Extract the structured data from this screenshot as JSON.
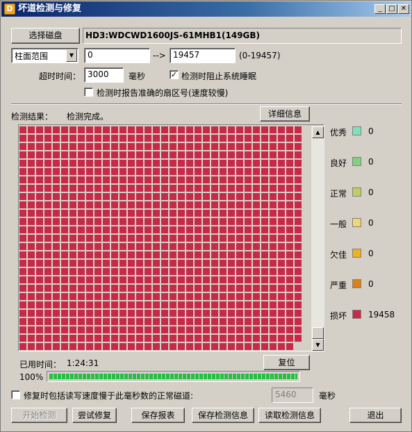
{
  "window": {
    "title": "坏道检测与修复",
    "app_icon": "app-icon"
  },
  "disk": {
    "select_label": "选择磁盘",
    "name": "HD3:WDCWD1600JS-61MHB1(149GB)"
  },
  "range": {
    "mode": "柱面范围",
    "from": "0",
    "arrow": "-->",
    "to": "19457",
    "hint": "(0-19457)"
  },
  "timeout": {
    "label": "超时时间：",
    "value": "3000",
    "unit": "毫秒"
  },
  "options": {
    "prevent_sleep": "检测时阻止系统睡眠",
    "prevent_sleep_checked": true,
    "report_sectors": "检测时报告准确的扇区号(速度较慢)",
    "report_sectors_checked": false
  },
  "result": {
    "label": "检测结果：",
    "status": "检测完成。",
    "details_button": "详细信息"
  },
  "legend": [
    {
      "label": "优秀",
      "count": "0",
      "color": "#80e0c0"
    },
    {
      "label": "良好",
      "count": "0",
      "color": "#80d080"
    },
    {
      "label": "正常",
      "count": "0",
      "color": "#c0d060"
    },
    {
      "label": "一般",
      "count": "0",
      "color": "#f0d870"
    },
    {
      "label": "欠佳",
      "count": "0",
      "color": "#f0b020"
    },
    {
      "label": "严重",
      "count": "0",
      "color": "#e08010"
    },
    {
      "label": "损坏",
      "count": "19458",
      "color": "#c62a46"
    }
  ],
  "elapsed": {
    "label": "已用时间：",
    "value": "1:24:31",
    "reset_button": "复位"
  },
  "progress": {
    "percent_text": "100%",
    "fraction": 1.0
  },
  "repair_option": {
    "label": "修复时包括读写速度慢于此毫秒数的正常磁道:",
    "checked": false,
    "value": "5460",
    "unit": "毫秒"
  },
  "buttons": {
    "start": "开始检测",
    "try_repair": "尝试修复",
    "save_report": "保存报表",
    "save_info": "保存检测信息",
    "load_info": "读取检测信息",
    "exit": "退出"
  },
  "colors": {
    "bad_block": "#c62a46",
    "progress": "#23c043",
    "titlebar": "#0a246a"
  }
}
